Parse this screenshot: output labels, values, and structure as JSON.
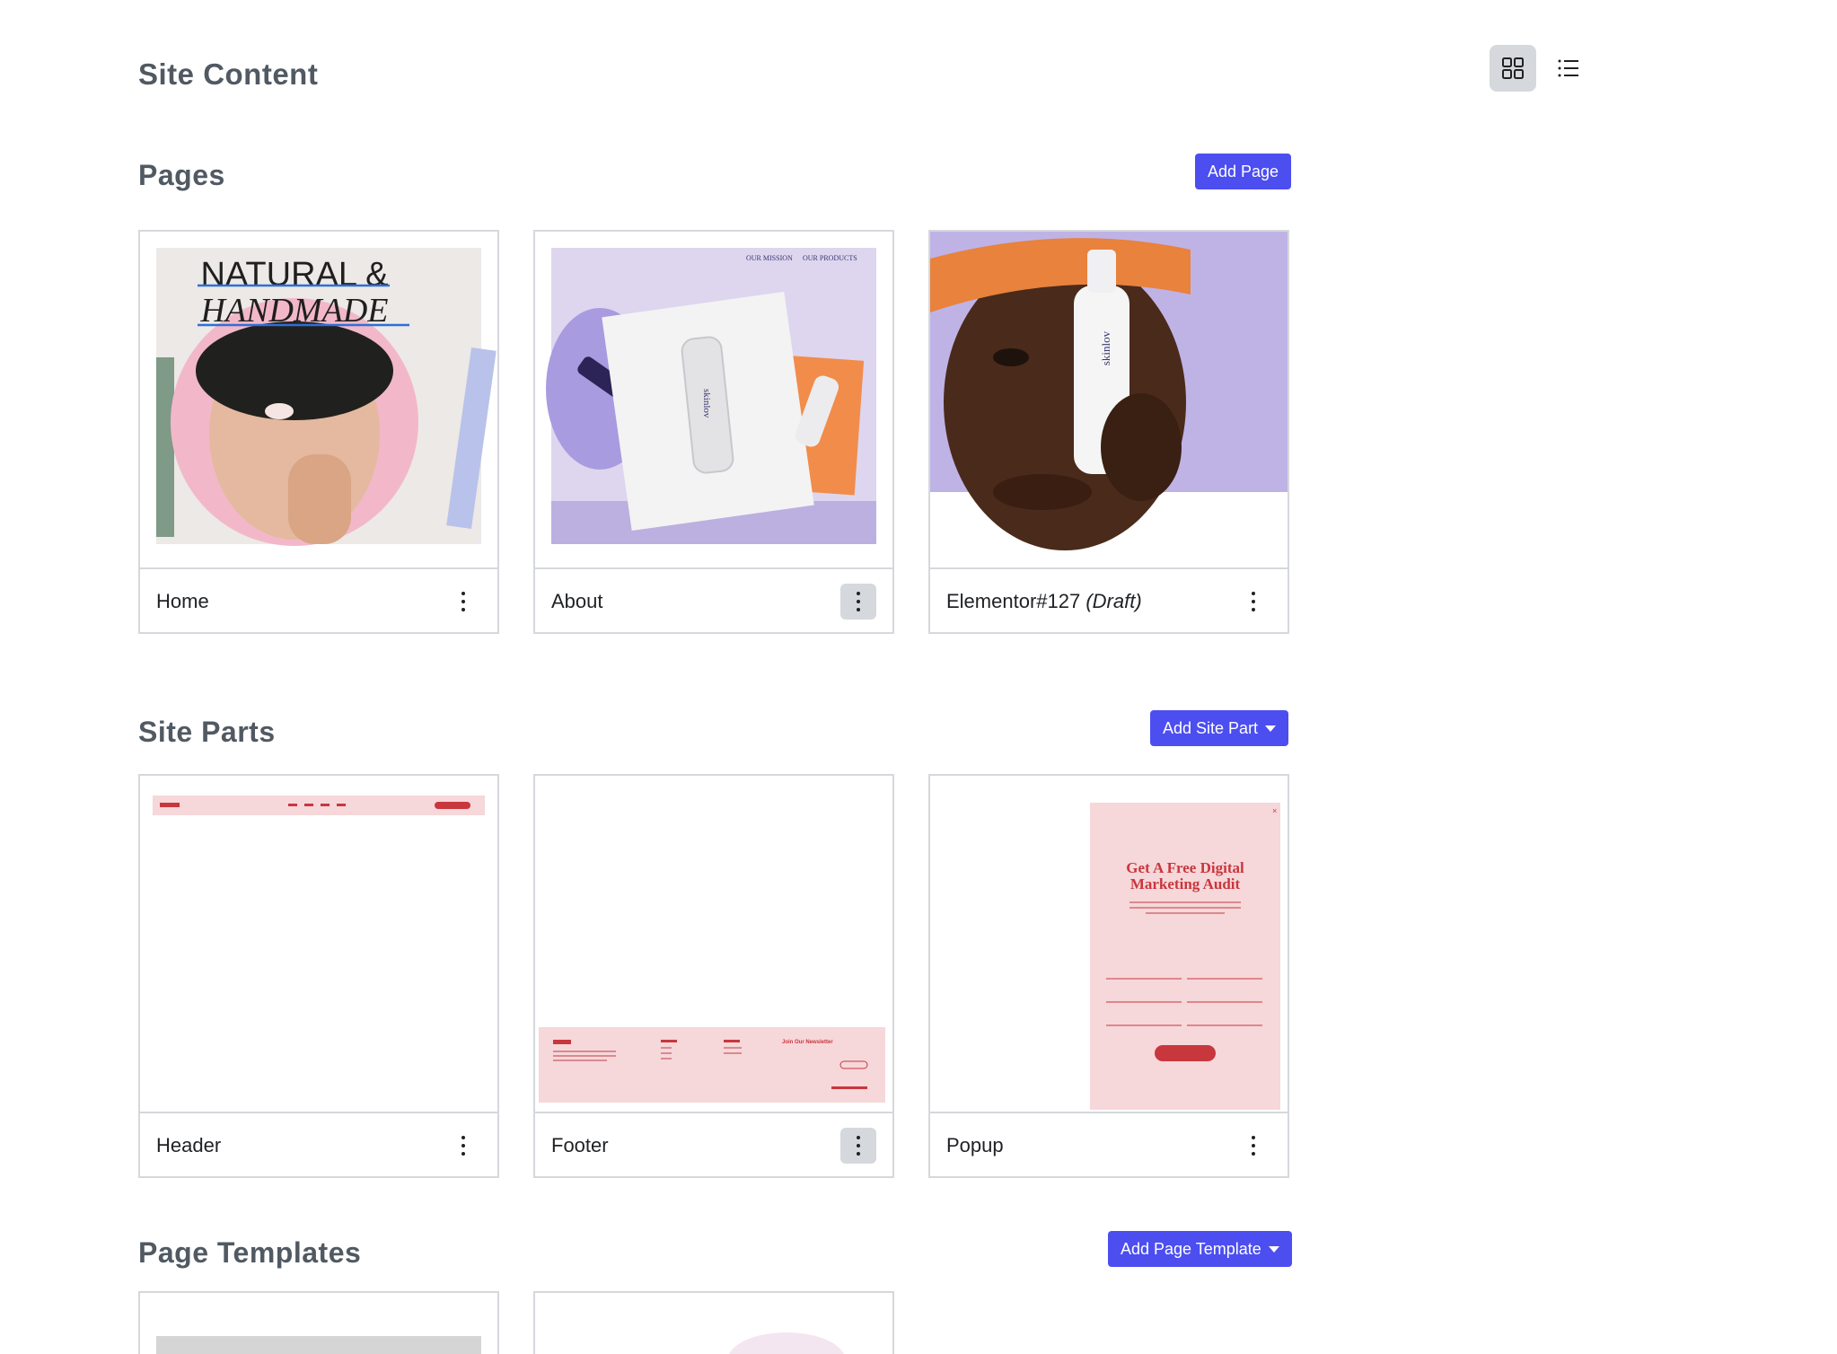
{
  "header": {
    "title": "Site Content",
    "grid_view_icon": "grid-icon",
    "list_view_icon": "list-icon"
  },
  "pages": {
    "title": "Pages",
    "add_label": "Add Page",
    "items": [
      {
        "name": "Home",
        "draft": "",
        "thumb_heading_1": "NATURAL &",
        "thumb_heading_2": "HANDMADE"
      },
      {
        "name": "About",
        "draft": "",
        "thumb_nav_1": "OUR MISSION",
        "thumb_nav_2": "OUR PRODUCTS",
        "thumb_brand": "skinlov"
      },
      {
        "name": "Elementor#127",
        "draft": "(Draft)",
        "thumb_brand": "skinlov"
      }
    ]
  },
  "site_parts": {
    "title": "Site Parts",
    "add_label": "Add Site Part",
    "items": [
      {
        "name": "Header"
      },
      {
        "name": "Footer",
        "thumb_newsletter": "Join Our Newsletter"
      },
      {
        "name": "Popup",
        "thumb_heading_1": "Get A Free Digital",
        "thumb_heading_2": "Marketing Audit"
      }
    ]
  },
  "page_templates": {
    "title": "Page Templates",
    "add_label": "Add Page Template"
  },
  "colors": {
    "accent": "#4c4ef0",
    "heading": "#515962",
    "border": "#d5d8dc",
    "active_bg": "#d5d8dc",
    "popup_red": "#c8373d"
  }
}
